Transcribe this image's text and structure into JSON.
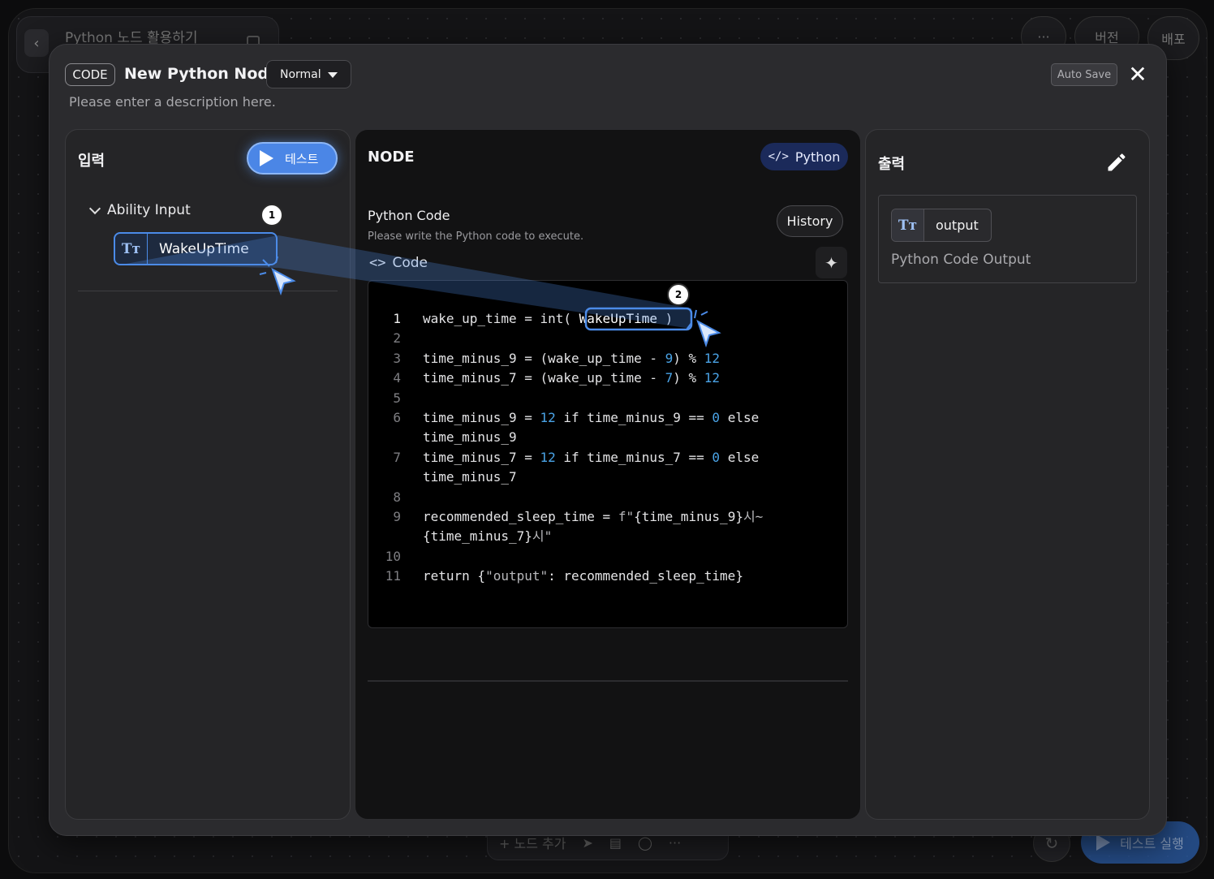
{
  "background": {
    "breadcrumb_title": "Python 노드 활용하기",
    "more_label": "···",
    "version_label": "버전",
    "deploy_label": "배포",
    "add_node_label": "+ 노드 추가",
    "run_test_label": "테스트 실행"
  },
  "header": {
    "type_badge": "CODE",
    "node_name": "New Python Node",
    "mode": "Normal",
    "description": "Please enter a description here.",
    "autosave_label": "Auto Save"
  },
  "input_panel": {
    "title": "입력",
    "test_button": "테스트",
    "group_label": "Ability Input",
    "variable": {
      "type_icon": "Tт",
      "name": "WakeUpTime"
    }
  },
  "node_panel": {
    "title": "NODE",
    "language": "Python",
    "field_label": "Python Code",
    "field_help": "Please write the Python code to execute.",
    "history_label": "History",
    "code_label": "Code"
  },
  "code_lines": [
    {
      "n": "1",
      "parts": [
        [
          "t",
          "wake_up_time = int( "
        ],
        [
          "v",
          "WakeUpTime"
        ],
        [
          "t",
          " )"
        ]
      ]
    },
    {
      "n": "2",
      "parts": []
    },
    {
      "n": "3",
      "parts": [
        [
          "t",
          "time_minus_9 = (wake_up_time - "
        ],
        [
          "n",
          "9"
        ],
        [
          "t",
          ") % "
        ],
        [
          "n",
          "12"
        ]
      ]
    },
    {
      "n": "4",
      "parts": [
        [
          "t",
          "time_minus_7 = (wake_up_time - "
        ],
        [
          "n",
          "7"
        ],
        [
          "t",
          ") % "
        ],
        [
          "n",
          "12"
        ]
      ]
    },
    {
      "n": "5",
      "parts": []
    },
    {
      "n": "6",
      "parts": [
        [
          "t",
          "time_minus_9 = "
        ],
        [
          "n",
          "12"
        ],
        [
          "t",
          " if time_minus_9 == "
        ],
        [
          "n",
          "0"
        ],
        [
          "t",
          " else"
        ]
      ]
    },
    {
      "n": "",
      "parts": [
        [
          "t",
          "time_minus_9"
        ]
      ]
    },
    {
      "n": "7",
      "parts": [
        [
          "t",
          "time_minus_7 = "
        ],
        [
          "n",
          "12"
        ],
        [
          "t",
          " if time_minus_7 == "
        ],
        [
          "n",
          "0"
        ],
        [
          "t",
          " else"
        ]
      ]
    },
    {
      "n": "",
      "parts": [
        [
          "t",
          "time_minus_7"
        ]
      ]
    },
    {
      "n": "8",
      "parts": []
    },
    {
      "n": "9",
      "parts": [
        [
          "t",
          "recommended_sleep_time = "
        ],
        [
          "s",
          "f\""
        ],
        [
          "t",
          "{time_minus_9}"
        ],
        [
          "s",
          "시~"
        ]
      ]
    },
    {
      "n": "",
      "parts": [
        [
          "t",
          "{time_minus_7}"
        ],
        [
          "s",
          "시\""
        ]
      ]
    },
    {
      "n": "10",
      "parts": []
    },
    {
      "n": "11",
      "parts": [
        [
          "t",
          "return {"
        ],
        [
          "s",
          "\"output\""
        ],
        [
          "t",
          ": recommended_sleep_time}"
        ]
      ]
    }
  ],
  "output_panel": {
    "title": "출력",
    "variable": {
      "type_icon": "Tт",
      "name": "output"
    },
    "description": "Python Code Output"
  },
  "annotations": {
    "step1": "1",
    "step2": "2"
  },
  "colors": {
    "accent": "#4b86e6",
    "number": "#4aa3e6",
    "python_badge": "#1b2a5a"
  }
}
